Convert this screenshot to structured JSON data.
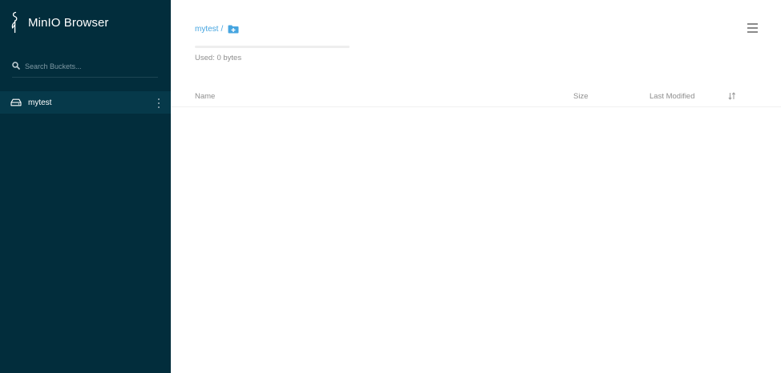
{
  "sidebar": {
    "app_title": "MinIO Browser",
    "search": {
      "placeholder": "Search Buckets...",
      "value": ""
    },
    "buckets": [
      {
        "name": "mytest",
        "selected": true
      }
    ]
  },
  "main": {
    "breadcrumb": {
      "bucket": "mytest",
      "separator": "/"
    },
    "usage": {
      "text": "Used: 0 bytes",
      "fraction": 0
    },
    "table": {
      "columns": {
        "name": "Name",
        "size": "Size",
        "last_modified": "Last Modified"
      },
      "rows": []
    }
  },
  "icons": {
    "logo": "minio-flamingo-icon",
    "search": "search-icon",
    "bucket": "bucket-drive-icon",
    "bucket_menu": "vertical-dots-icon",
    "new_folder": "folder-plus-icon",
    "menu": "hamburger-menu-icon",
    "sort": "sort-arrows-icon"
  },
  "colors": {
    "sidebar_bg": "#022d3c",
    "sidebar_selected": "#06394a",
    "accent": "#46a5e0",
    "muted_text": "#8e8e8e"
  }
}
